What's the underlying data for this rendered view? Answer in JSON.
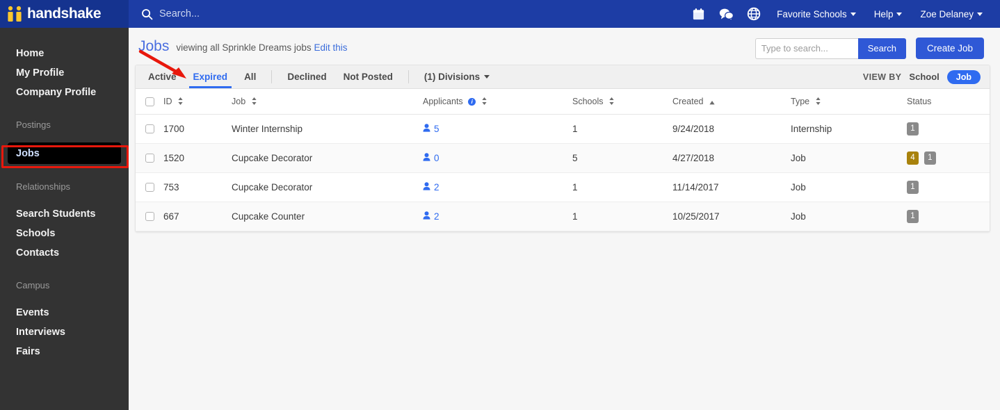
{
  "brand": {
    "name": "handshake",
    "logo_icon": "handshake-logo-icon",
    "accent_blue": "#1d3da5",
    "accent_yellow": "#ffc82e"
  },
  "topnav": {
    "search_placeholder": "Search...",
    "search_icon": "search-icon",
    "icons": [
      {
        "name": "calendar-icon"
      },
      {
        "name": "messages-icon"
      },
      {
        "name": "globe-icon"
      }
    ],
    "links": [
      {
        "label": "Favorite Schools",
        "caret": true
      },
      {
        "label": "Help",
        "caret": true
      },
      {
        "label": "Zoe Delaney",
        "caret": true
      }
    ]
  },
  "sidebar": {
    "items": [
      {
        "label": "Home"
      },
      {
        "label": "My Profile"
      },
      {
        "label": "Company Profile"
      }
    ],
    "groups": [
      {
        "label": "Postings",
        "items": [
          {
            "label": "Jobs",
            "active": true
          }
        ]
      },
      {
        "label": "Relationships",
        "items": [
          {
            "label": "Search Students"
          },
          {
            "label": "Schools"
          },
          {
            "label": "Contacts"
          }
        ]
      },
      {
        "label": "Campus",
        "items": [
          {
            "label": "Events"
          },
          {
            "label": "Interviews"
          },
          {
            "label": "Fairs"
          }
        ]
      }
    ]
  },
  "page": {
    "title": "Jobs",
    "subtitle": "viewing all Sprinkle Dreams jobs",
    "edit_link": "Edit this",
    "search": {
      "placeholder": "Type to search...",
      "value": "",
      "button_label": "Search"
    },
    "create_button": "Create Job"
  },
  "tabs": [
    {
      "label": "Active",
      "active": false
    },
    {
      "label": "Expired",
      "active": true
    },
    {
      "label": "All",
      "active": false
    },
    {
      "label": "Declined",
      "active": false
    },
    {
      "label": "Not Posted",
      "active": false
    },
    {
      "label": "(1) Divisions",
      "active": false,
      "caret": true
    }
  ],
  "view_by": {
    "label": "VIEW BY",
    "options": [
      {
        "label": "School",
        "selected": false
      },
      {
        "label": "Job",
        "selected": true
      }
    ]
  },
  "table": {
    "columns": [
      {
        "key": "checkbox",
        "label": "",
        "sortable": false
      },
      {
        "key": "id",
        "label": "ID",
        "sortable": true
      },
      {
        "key": "job",
        "label": "Job",
        "sortable": true
      },
      {
        "key": "applicants",
        "label": "Applicants",
        "sortable": true,
        "info": true
      },
      {
        "key": "schools",
        "label": "Schools",
        "sortable": true
      },
      {
        "key": "created",
        "label": "Created",
        "sortable": true,
        "sorted": "asc"
      },
      {
        "key": "type",
        "label": "Type",
        "sortable": true
      },
      {
        "key": "status",
        "label": "Status",
        "sortable": false
      }
    ],
    "rows": [
      {
        "id": "1700",
        "job": "Winter Internship",
        "applicants": "5",
        "schools": "1",
        "created": "9/24/2018",
        "type": "Internship",
        "status": [
          {
            "count": "1",
            "color": "gray"
          }
        ]
      },
      {
        "id": "1520",
        "job": "Cupcake Decorator",
        "applicants": "0",
        "schools": "5",
        "created": "4/27/2018",
        "type": "Job",
        "status": [
          {
            "count": "4",
            "color": "gold"
          },
          {
            "count": "1",
            "color": "gray"
          }
        ]
      },
      {
        "id": "753",
        "job": "Cupcake Decorator",
        "applicants": "2",
        "schools": "1",
        "created": "11/14/2017",
        "type": "Job",
        "status": [
          {
            "count": "1",
            "color": "gray"
          }
        ]
      },
      {
        "id": "667",
        "job": "Cupcake Counter",
        "applicants": "2",
        "schools": "1",
        "created": "10/25/2017",
        "type": "Job",
        "status": [
          {
            "count": "1",
            "color": "gray"
          }
        ]
      }
    ]
  },
  "annotations": {
    "arrow_color": "#e8180c",
    "box_color": "#e8180c",
    "arrow_target": "Expired",
    "box_target": "Jobs"
  }
}
